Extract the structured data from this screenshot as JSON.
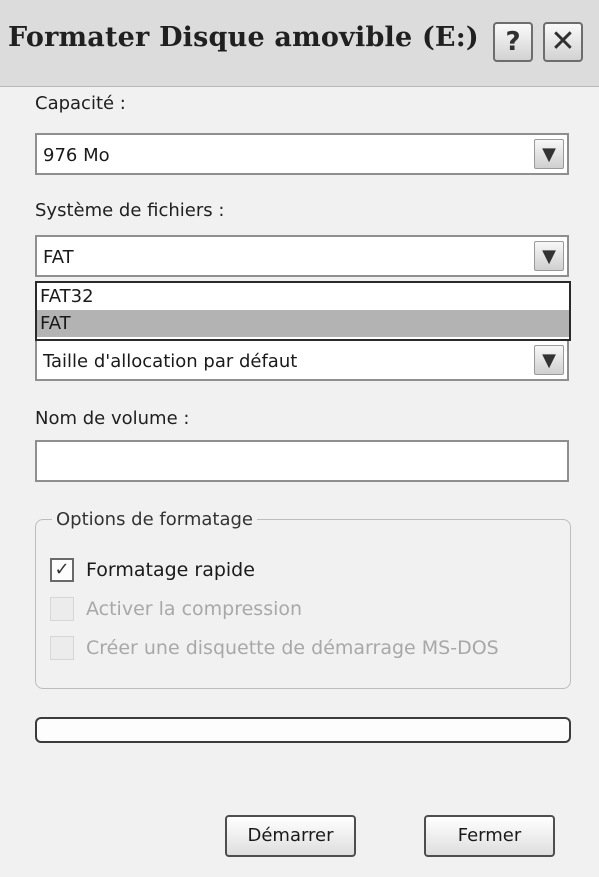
{
  "window": {
    "title": "Formater Disque amovible (E:)",
    "help_button": "?",
    "close_button": "✕"
  },
  "capacity": {
    "label": "Capacité :",
    "value": "976 Mo"
  },
  "filesystem": {
    "label": "Système de fichiers :",
    "value": "FAT",
    "options": [
      "FAT32",
      "FAT"
    ],
    "selected_index": 1
  },
  "allocation": {
    "value": "Taille d'allocation par défaut"
  },
  "volume": {
    "label": "Nom de volume :",
    "value": ""
  },
  "format_options": {
    "title": "Options de formatage",
    "items": [
      {
        "label": "Formatage rapide",
        "checked": true,
        "enabled": true
      },
      {
        "label": "Activer la compression",
        "checked": false,
        "enabled": false
      },
      {
        "label": "Créer une disquette de démarrage MS-DOS",
        "checked": false,
        "enabled": false
      }
    ]
  },
  "progress": {
    "value": 0
  },
  "buttons": {
    "start": "Démarrer",
    "close": "Fermer"
  },
  "icons": {
    "dropdown_arrow": "chevron-down-icon",
    "check": "check-icon"
  }
}
